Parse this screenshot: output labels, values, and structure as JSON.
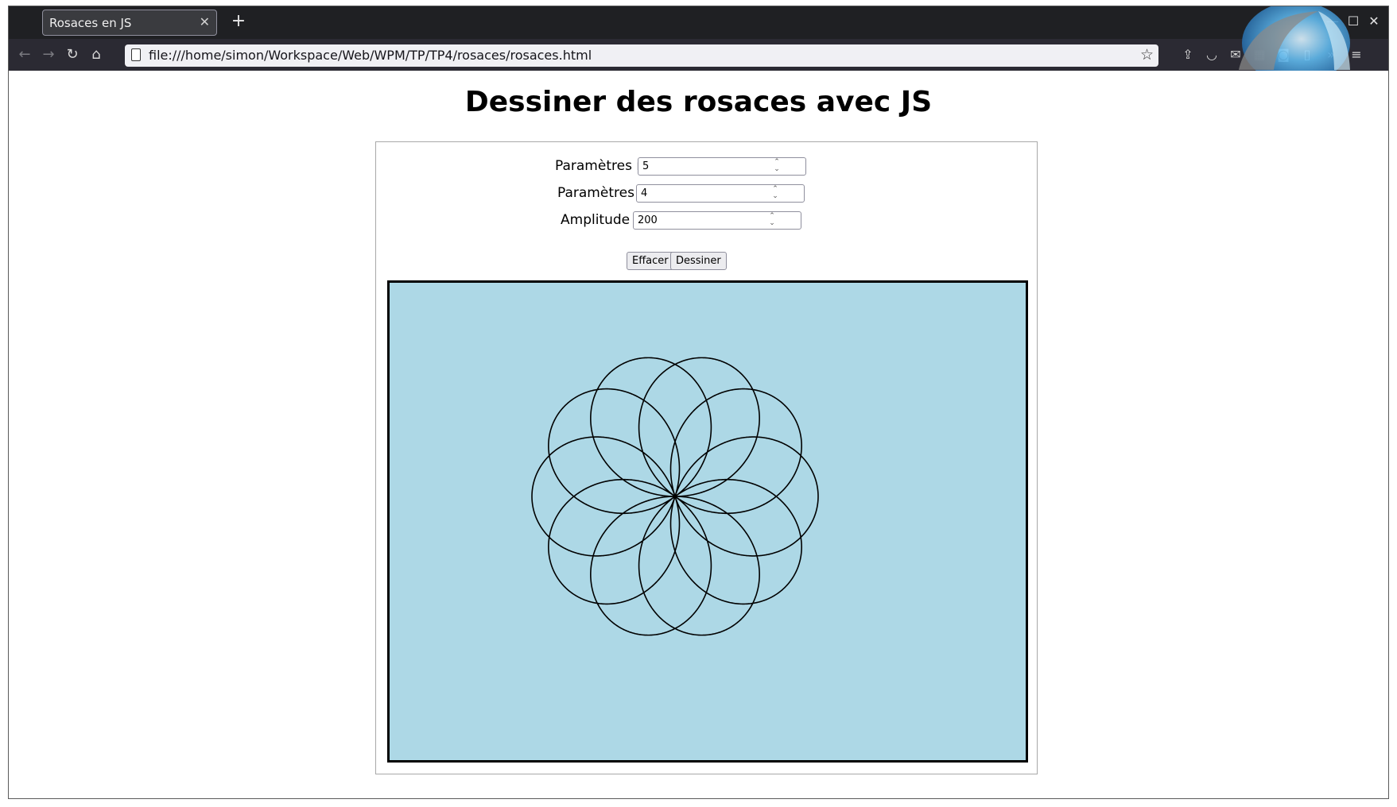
{
  "browser": {
    "tab_title": "Rosaces en JS",
    "tab_close": "✕",
    "new_tab": "+",
    "url": "file:///home/simon/Workspace/Web/WPM/TP/TP4/rosaces/rosaces.html",
    "icons": [
      "back-icon",
      "forward-icon",
      "reload-icon",
      "home-icon",
      "bookmark-star-icon",
      "pocket-icon",
      "mail-icon",
      "calendar-icon",
      "video-icon",
      "reader-icon",
      "overflow-icon",
      "menu-icon"
    ]
  },
  "page": {
    "title": "Dessiner des rosaces avec JS",
    "form": {
      "m_label": "Paramètres m",
      "m_value": "5",
      "n_label": "Paramètres n",
      "n_value": "4",
      "a_label": "Amplitude A",
      "a_value": "200",
      "clear_button": "Effacer",
      "draw_button": "Dessiner"
    },
    "canvas": {
      "background": "#add8e6",
      "stroke": "#000000",
      "m": 5,
      "n": 4,
      "amplitude": 200
    }
  }
}
